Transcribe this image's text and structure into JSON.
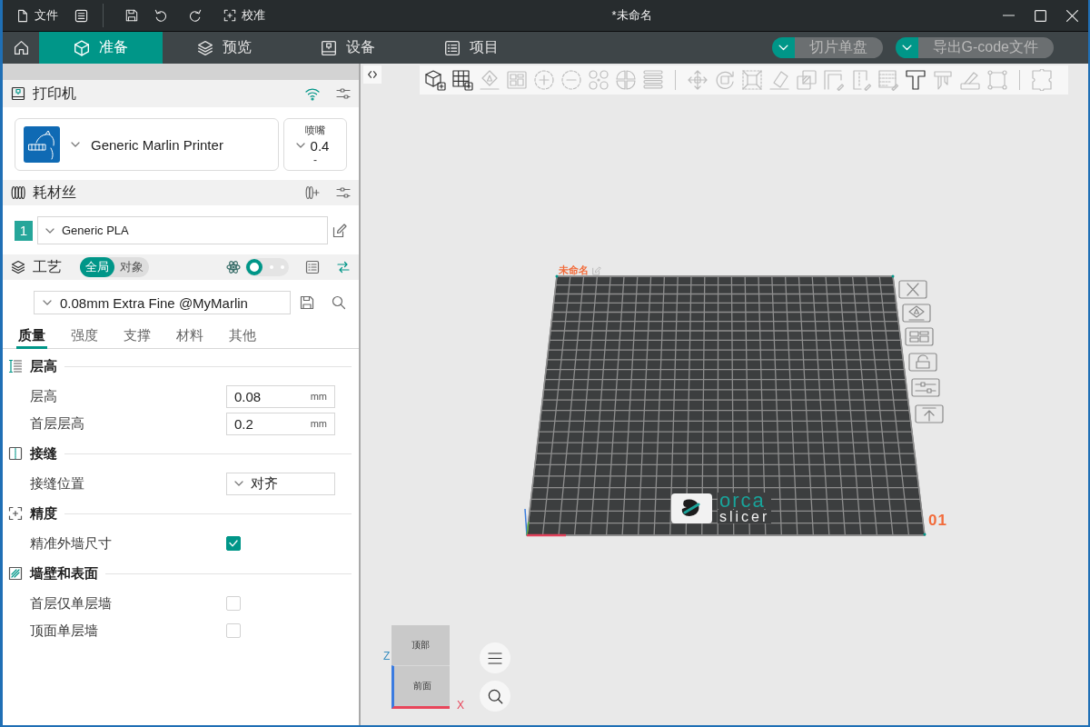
{
  "window": {
    "title": "*未命名"
  },
  "title_bar": {
    "file_menu": "文件",
    "calibration": "校准"
  },
  "main_tabs": [
    {
      "label": "准备",
      "selected": true
    },
    {
      "label": "预览",
      "selected": false
    },
    {
      "label": "设备",
      "selected": false
    },
    {
      "label": "项目",
      "selected": false
    }
  ],
  "actions": [
    {
      "label": "切片单盘",
      "disabled": true
    },
    {
      "label": "导出G-code文件",
      "disabled": true
    }
  ],
  "sidebar": {
    "printer": {
      "title": "打印机",
      "name": "Generic Marlin Printer",
      "nozzle": {
        "label": "喷嘴",
        "value": "0.4",
        "sub_value": "-"
      }
    },
    "filament": {
      "title": "耗材丝",
      "items": [
        {
          "number": "1",
          "name": "Generic PLA",
          "color": "#26a69a"
        }
      ]
    },
    "process": {
      "title": "工艺",
      "scope": [
        {
          "label": "全局",
          "selected": true
        },
        {
          "label": "对象",
          "selected": false
        }
      ],
      "advanced": {
        "on": false
      },
      "preset": "0.08mm Extra Fine @MyMarlin",
      "tabs": [
        {
          "label": "质量",
          "selected": true
        },
        {
          "label": "强度",
          "selected": false
        },
        {
          "label": "支撑",
          "selected": false
        },
        {
          "label": "材料",
          "selected": false
        },
        {
          "label": "其他",
          "selected": false
        }
      ]
    },
    "settings": [
      {
        "title": "层高",
        "rows": [
          {
            "kind": "number",
            "label": "层高",
            "value": "0.08",
            "unit": "mm"
          },
          {
            "kind": "number",
            "label": "首层层高",
            "value": "0.2",
            "unit": "mm"
          }
        ]
      },
      {
        "title": "接缝",
        "rows": [
          {
            "kind": "select",
            "label": "接缝位置",
            "value": "对齐"
          }
        ]
      },
      {
        "title": "精度",
        "rows": [
          {
            "kind": "checkbox",
            "label": "精准外墙尺寸",
            "checked": true
          }
        ]
      },
      {
        "title": "墙壁和表面",
        "rows": [
          {
            "kind": "checkbox",
            "label": "首层仅单层墙",
            "checked": false
          },
          {
            "kind": "checkbox",
            "label": "顶面单层墙",
            "checked": false
          }
        ]
      }
    ]
  },
  "viewport": {
    "toolbar_groups": [
      [
        {
          "disabled": false
        },
        {
          "disabled": false
        },
        {
          "disabled": true
        },
        {
          "disabled": true
        },
        {
          "disabled": true
        },
        {
          "disabled": true
        },
        {
          "disabled": true
        },
        {
          "disabled": true
        },
        {
          "disabled": true
        }
      ],
      [
        {
          "disabled": true
        },
        {
          "disabled": true
        },
        {
          "disabled": true
        },
        {
          "disabled": true
        },
        {
          "disabled": true
        },
        {
          "disabled": true
        },
        {
          "disabled": true
        },
        {
          "disabled": true
        },
        {
          "disabled": false
        },
        {
          "disabled": true
        },
        {
          "disabled": true
        },
        {
          "disabled": true
        }
      ],
      [
        {
          "disabled": true
        }
      ]
    ],
    "plate": {
      "name": "未命名",
      "number": "01",
      "logo": [
        "orca",
        "slicer"
      ]
    },
    "view_cube": {
      "top": "顶部",
      "front": "前面",
      "z_axis": "Z",
      "x_axis": "X"
    }
  }
}
